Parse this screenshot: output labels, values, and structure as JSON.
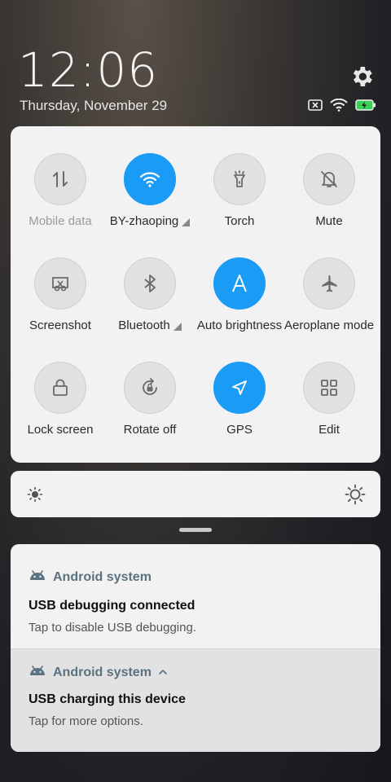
{
  "status_bar": {
    "time": "12:06",
    "date": "Thursday, November 29",
    "icons": [
      "no-sim-icon",
      "wifi-icon",
      "battery-charging-icon"
    ]
  },
  "settings_icon": "gear-icon",
  "quick_settings": {
    "tiles": [
      {
        "label": "Mobile data",
        "icon": "data-arrows-icon",
        "active": false,
        "dimmed": true
      },
      {
        "label": "BY-zhaoping",
        "icon": "wifi-icon",
        "active": true,
        "expand": true
      },
      {
        "label": "Torch",
        "icon": "torch-icon",
        "active": false
      },
      {
        "label": "Mute",
        "icon": "bell-off-icon",
        "active": false
      },
      {
        "label": "Screenshot",
        "icon": "screenshot-icon",
        "active": false
      },
      {
        "label": "Bluetooth",
        "icon": "bluetooth-icon",
        "active": false,
        "expand": true
      },
      {
        "label": "Auto brightness",
        "icon": "auto-brightness-icon",
        "active": true
      },
      {
        "label": "Aeroplane mode",
        "icon": "airplane-icon",
        "active": false
      },
      {
        "label": "Lock screen",
        "icon": "lock-icon",
        "active": false
      },
      {
        "label": "Rotate off",
        "icon": "rotate-lock-icon",
        "active": false
      },
      {
        "label": "GPS",
        "icon": "location-arrow-icon",
        "active": true
      },
      {
        "label": "Edit",
        "icon": "grid-icon",
        "active": false
      }
    ]
  },
  "brightness": {
    "min_icon": "sun-small-icon",
    "max_icon": "sun-large-icon"
  },
  "notifications": [
    {
      "app": "Android system",
      "title": "USB debugging connected",
      "text": "Tap to disable USB debugging.",
      "expandable": false
    },
    {
      "app": "Android system",
      "title": "USB charging this device",
      "text": "Tap for more options.",
      "expandable": true
    }
  ],
  "colors": {
    "accent": "#1a9bf5",
    "panel": "#f2f2f2",
    "app_name": "#5b7281"
  }
}
